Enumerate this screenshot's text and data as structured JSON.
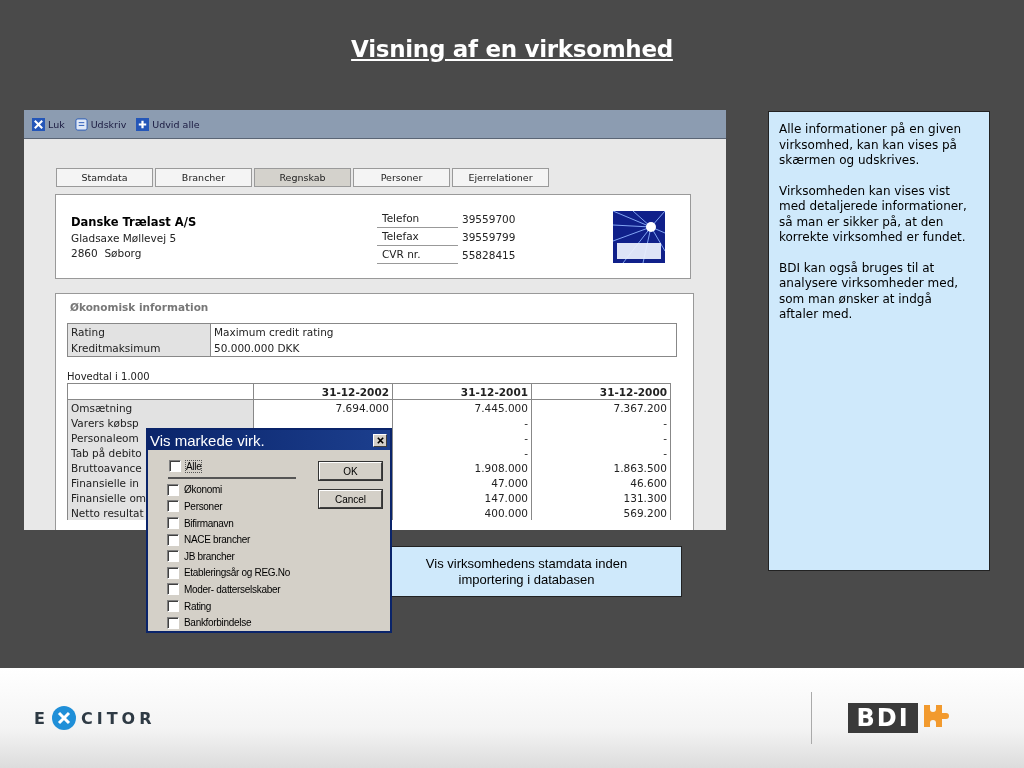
{
  "slide": {
    "title": "Visning af en virksomhed"
  },
  "app": {
    "toolbar": [
      {
        "label": "Luk",
        "kind": "close"
      },
      {
        "label": "Udskriv",
        "kind": "print"
      },
      {
        "label": "Udvid alle",
        "kind": "expand"
      }
    ],
    "tabs": [
      {
        "label": "Stamdata",
        "selected": false
      },
      {
        "label": "Brancher",
        "selected": false
      },
      {
        "label": "Regnskab",
        "selected": true
      },
      {
        "label": "Personer",
        "selected": false
      },
      {
        "label": "Ejerrelationer",
        "selected": false
      }
    ],
    "company": {
      "name": "Danske Trælast A/S",
      "address": "Gladsaxe Møllevej 5",
      "city": "2860  Søborg",
      "details": [
        {
          "label": "Telefon",
          "value": "39559700"
        },
        {
          "label": "Telefax",
          "value": "39559799"
        },
        {
          "label": "CVR nr.",
          "value": "55828415"
        }
      ]
    },
    "economic": {
      "title": "Økonomisk information",
      "summary": [
        {
          "label": "Rating",
          "value": "Maximum credit rating"
        },
        {
          "label": "Kreditmaksimum",
          "value": "50.000.000 DKK"
        }
      ],
      "caption": "Hovedtal i 1.000",
      "columns": [
        "31-12-2002",
        "31-12-2001",
        "31-12-2000"
      ],
      "rows": [
        {
          "label": "Omsætning",
          "values": [
            "7.694.000",
            "7.445.000",
            "7.367.200"
          ]
        },
        {
          "label": "Varers købsp",
          "values": [
            "-",
            "-"
          ]
        },
        {
          "label": "Personaleom",
          "values": [
            "-",
            "-"
          ]
        },
        {
          "label": "Tab på debito",
          "values": [
            "-",
            "-"
          ]
        },
        {
          "label": "Bruttoavance",
          "values": [
            "1.908.000",
            "1.863.500"
          ]
        },
        {
          "label": "Finansielle in",
          "values": [
            "47.000",
            "46.600"
          ]
        },
        {
          "label": "Finansielle om",
          "values": [
            "147.000",
            "131.300"
          ]
        },
        {
          "label": "Netto resultat",
          "values": [
            "400.000",
            "569.200"
          ]
        }
      ]
    }
  },
  "dialog": {
    "title": "Vis markede virk.",
    "all": {
      "label": "Alle",
      "checked": false
    },
    "options": [
      {
        "label": "Økonomi",
        "checked": false
      },
      {
        "label": "Personer",
        "checked": false
      },
      {
        "label": "Bifirmanavn",
        "checked": false
      },
      {
        "label": "NACE brancher",
        "checked": false
      },
      {
        "label": "JB brancher",
        "checked": false
      },
      {
        "label": "Etableringsår og REG.No",
        "checked": false
      },
      {
        "label": "Moder- datterselskaber",
        "checked": false
      },
      {
        "label": "Rating",
        "checked": false
      },
      {
        "label": "Bankforbindelse",
        "checked": false
      }
    ],
    "buttons": [
      "OK",
      "Cancel"
    ]
  },
  "notes": [
    "Alle informationer på en given virksomhed, kan kan vises på skærmen og udskrives.",
    "Virksomheden kan vises vist med detaljerede informationer, så man er sikker på, at den korrekte virksomhed er fundet.",
    "BDI kan også bruges til at analysere virksomheder med, som man ønsker at indgå aftaler med."
  ],
  "callout": "Vis virksomhedens stamdata inden importering i databasen",
  "footer": {
    "left_logo": [
      "E",
      "CITOR"
    ],
    "right_logo": "BDI"
  }
}
